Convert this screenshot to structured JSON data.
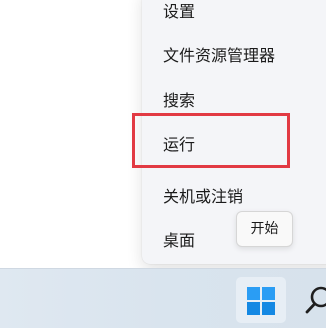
{
  "start_context_menu": {
    "items": [
      {
        "label": "设置"
      },
      {
        "label": "文件资源管理器"
      },
      {
        "label": "搜索"
      },
      {
        "label": "运行"
      },
      {
        "label": "关机或注销"
      },
      {
        "label": "桌面"
      }
    ],
    "highlighted_item": "运行",
    "highlight_color": "#e23a43"
  },
  "tooltip": {
    "text": "开始"
  },
  "taskbar": {
    "start_icon": "windows-logo-icon",
    "search_icon": "search-icon",
    "accent_color": "#1c9ae8"
  }
}
